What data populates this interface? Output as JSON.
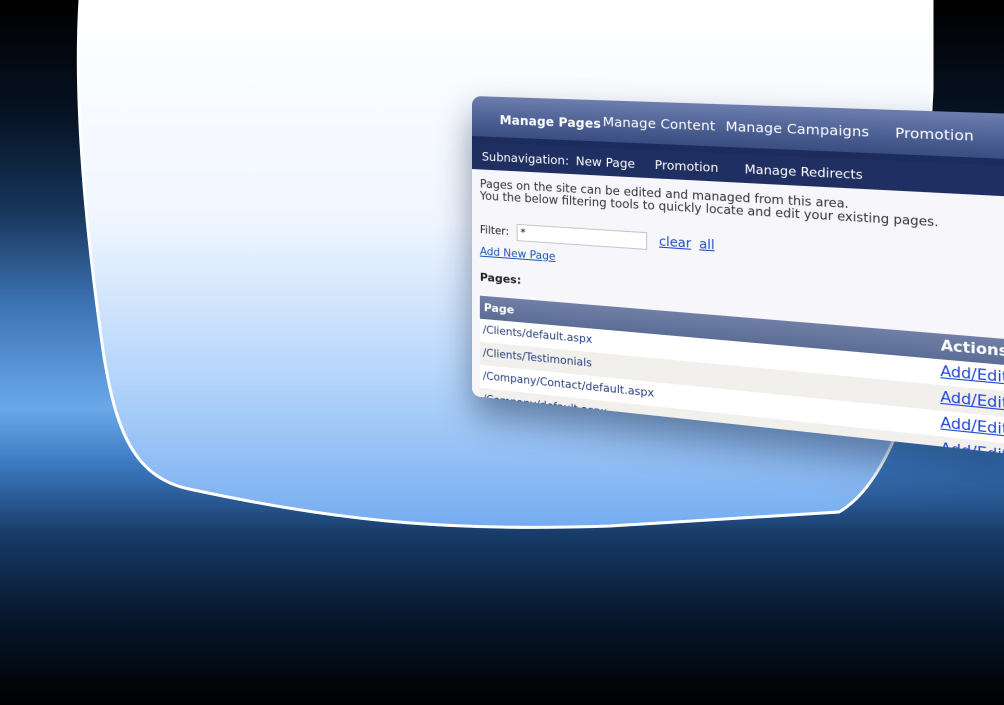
{
  "main_nav": {
    "items": [
      {
        "label": "Manage Pages",
        "active": true
      },
      {
        "label": "Manage Content",
        "active": false
      },
      {
        "label": "Manage Campaigns",
        "active": false
      },
      {
        "label": "Promotion",
        "active": false
      }
    ]
  },
  "subnav": {
    "label": "Subnavigation:",
    "items": [
      {
        "label": "New Page"
      },
      {
        "label": "Promotion"
      },
      {
        "label": "Manage Redirects"
      }
    ]
  },
  "intro": {
    "line1": "Pages on the site can be edited and managed from this area.",
    "line2": "You the below filtering tools to quickly locate and edit your existing pages."
  },
  "filter": {
    "label": "Filter:",
    "value": "*",
    "clear_label": "clear",
    "all_label": "all"
  },
  "add_new_page": "Add New Page",
  "pages_title": "Pages:",
  "table": {
    "columns": [
      "Page",
      "Actions"
    ],
    "rows": [
      {
        "page": "/Clients/default.aspx",
        "action": "Add/Edit"
      },
      {
        "page": "/Clients/Testimonials",
        "action": "Add/Edit"
      },
      {
        "page": "/Company/Contact/default.aspx",
        "action": "Add/Edit"
      },
      {
        "page": "/Company/default.aspx",
        "action": "Add/Edit"
      }
    ]
  },
  "colors": {
    "nav_blue": "#4a5d91",
    "subnav_blue": "#1f2f61",
    "link_blue": "#2046d6",
    "table_header": "#6f7fa6"
  }
}
